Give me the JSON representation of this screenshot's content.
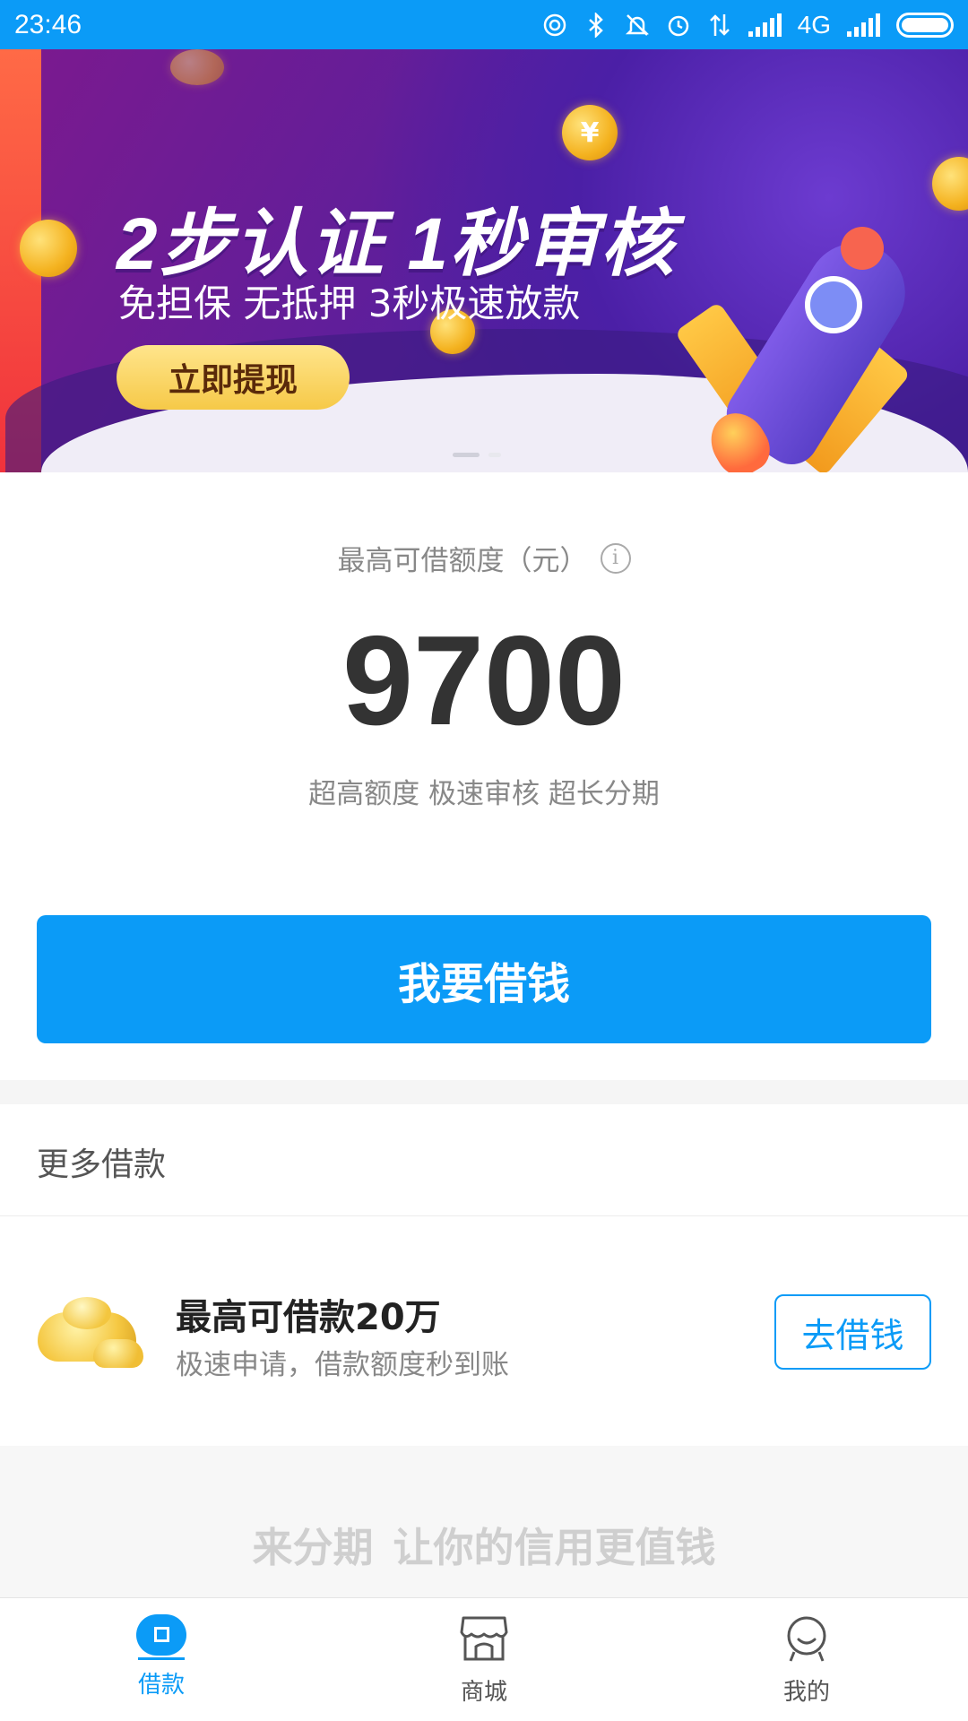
{
  "status_bar": {
    "time": "23:46",
    "network": "4G",
    "icons": [
      "hotspot-icon",
      "bluetooth-icon",
      "mute-icon",
      "alarm-icon",
      "data-arrows-icon",
      "signal-icon",
      "signal-icon",
      "battery-icon"
    ]
  },
  "banner": {
    "headline": "2步认证 1秒审核",
    "subline": "免担保 无抵押 3秒极速放款",
    "cta": "立即提现",
    "coin_symbol": "¥",
    "page_count": 2,
    "active_page": 1
  },
  "limit": {
    "label": "最高可借额度（元）",
    "info_glyph": "i",
    "amount": "9700",
    "subtitle": "超高额度 极速审核 超长分期"
  },
  "primary_button": "我要借钱",
  "more_loans": {
    "title": "更多借款",
    "items": [
      {
        "title": "最高可借款20万",
        "desc": "极速申请，借款额度秒到账",
        "button": "去借钱"
      }
    ]
  },
  "slogan": {
    "emphasis": "来分期",
    "text": "让你的信用更值钱"
  },
  "tabbar": {
    "tabs": [
      {
        "label": "借款",
        "icon": "loan-icon",
        "active": true
      },
      {
        "label": "商城",
        "icon": "shop-icon",
        "active": false
      },
      {
        "label": "我的",
        "icon": "profile-icon",
        "active": false
      }
    ]
  },
  "colors": {
    "primary": "#0b9bf7",
    "status_bar": "#0b9bf7",
    "amount_text": "#333333"
  }
}
